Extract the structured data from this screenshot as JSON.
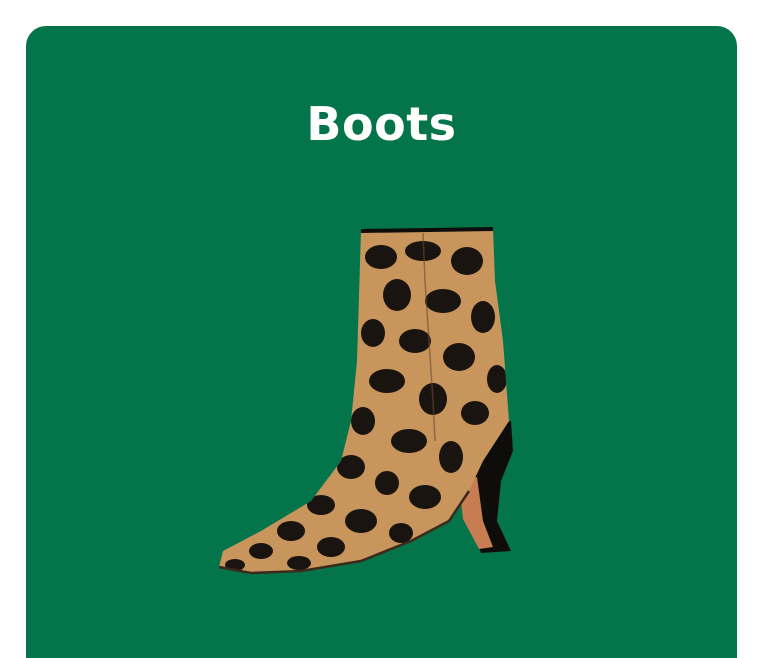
{
  "card": {
    "title": "Boots",
    "image_icon": "leopard-print-ankle-boot-image",
    "background_color": "#04754b",
    "title_color": "#ffffff"
  }
}
